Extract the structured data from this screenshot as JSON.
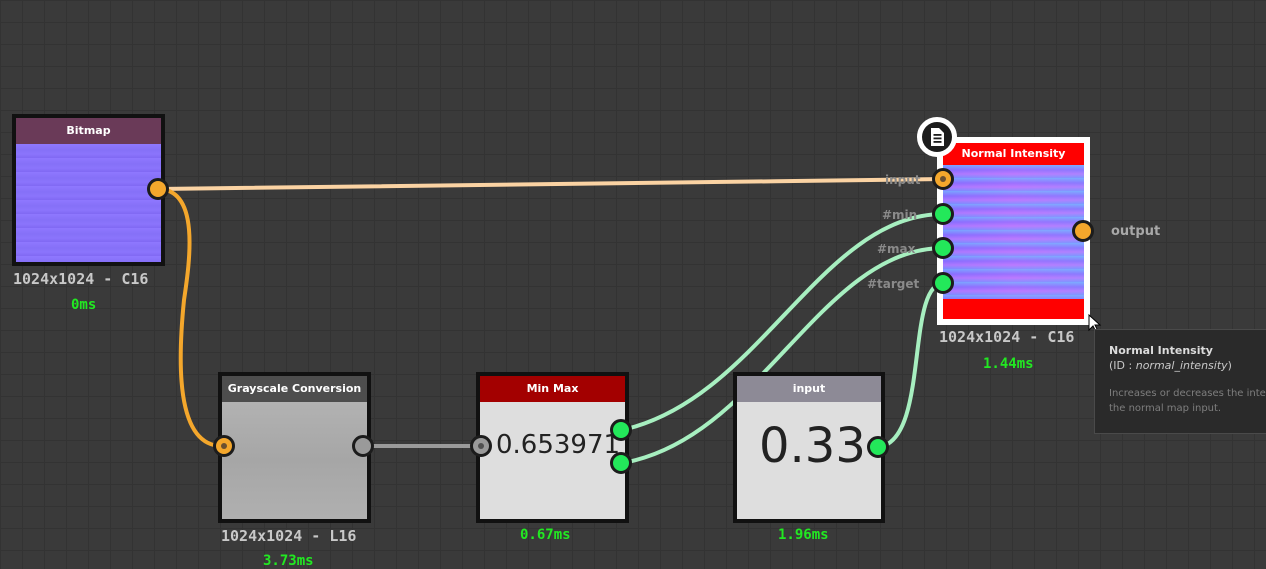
{
  "nodes": {
    "bitmap": {
      "title": "Bitmap",
      "resolution": "1024x1024 - C16",
      "time": "0ms"
    },
    "grayscale": {
      "title": "Grayscale Conversion",
      "resolution": "1024x1024 - L16",
      "time": "3.73ms"
    },
    "minmax": {
      "title": "Min Max",
      "value": "0.653971",
      "time": "0.67ms"
    },
    "input_value": {
      "title": "input",
      "value": "0.33",
      "time": "1.96ms"
    },
    "normal_intensity": {
      "title": "Normal Intensity",
      "resolution": "1024x1024 - C16",
      "time": "1.44ms",
      "inputs": [
        "input",
        "#min",
        "#max",
        "#target"
      ],
      "output": "output"
    }
  },
  "tooltip": {
    "title": "Normal Intensity",
    "id_prefix": "(ID : ",
    "id_value": "normal_intensity",
    "id_suffix": ")",
    "description": "Increases or decreases the intensity of the normal map input."
  },
  "icons": {
    "doc_badge": "document-icon",
    "cursor": "mouse-cursor-icon"
  },
  "colors": {
    "wire_orange": "#f4a72c",
    "wire_peach": "#fbd3a3",
    "wire_green": "#a7efc0",
    "wire_grey": "#9a9a9a",
    "time_green": "#22e822",
    "bitmap_header": "#6a3a58",
    "minmax_header": "#a30000",
    "normal_header": "#ff0000"
  }
}
